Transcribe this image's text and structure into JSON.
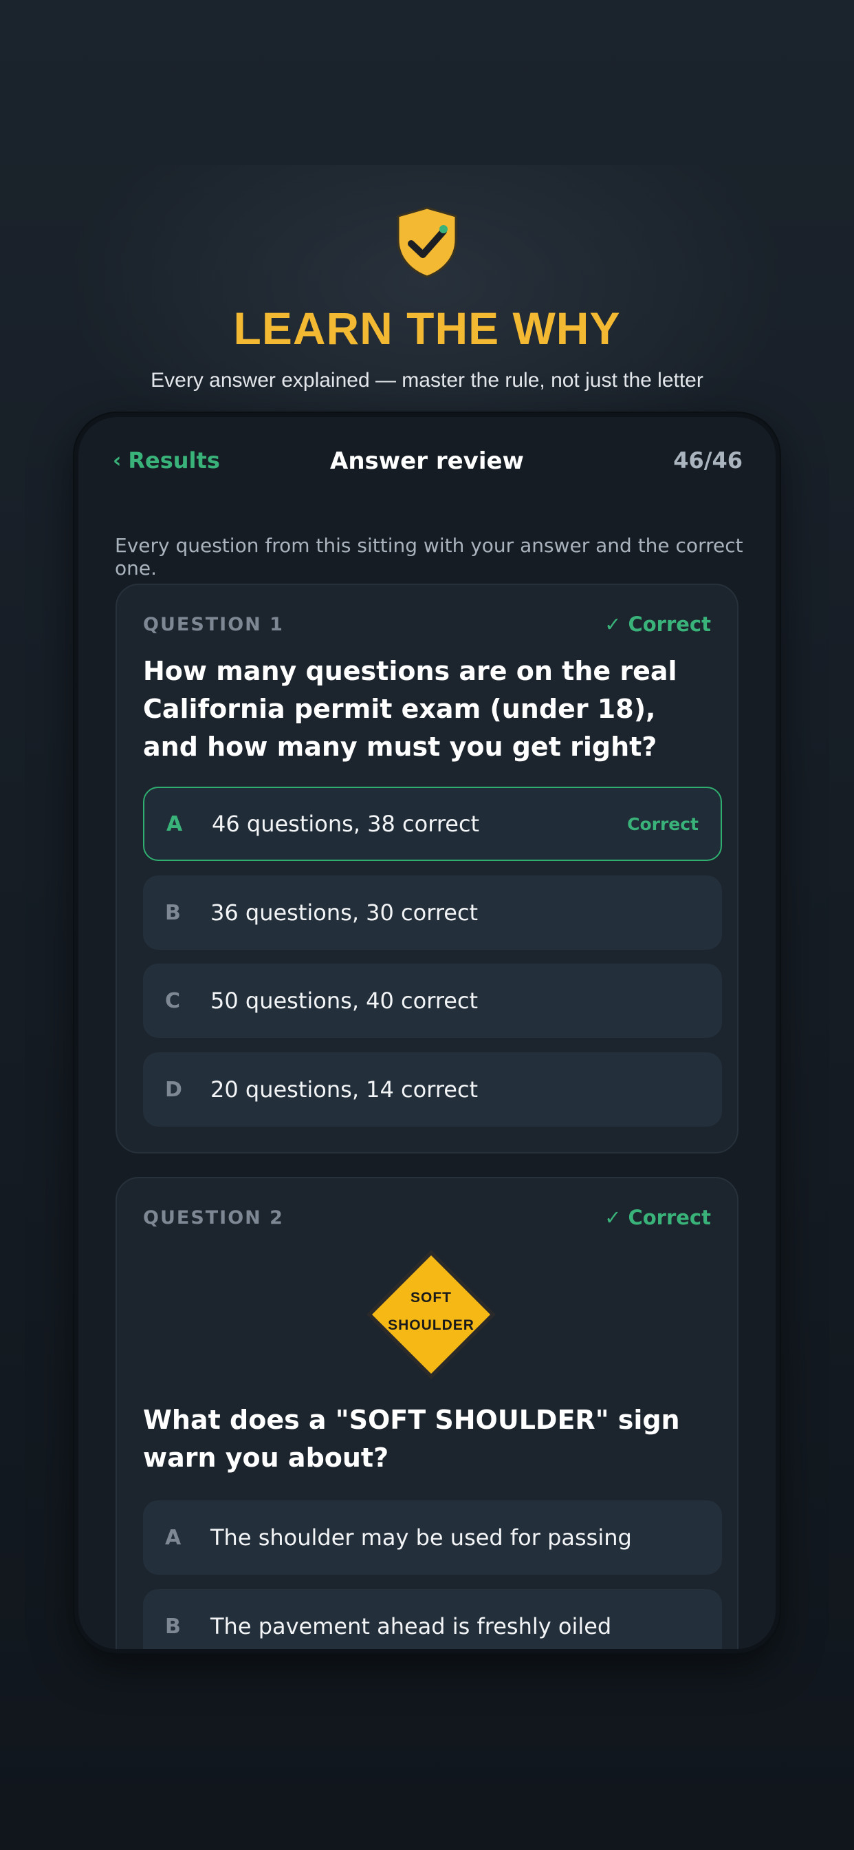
{
  "hero": {
    "icon": "shield-check-icon",
    "title": "LEARN THE WHY",
    "subtitle": "Every answer explained — master the rule, not just the letter"
  },
  "nav": {
    "back_label": "Results",
    "back_icon": "chevron-left-icon",
    "title": "Answer review",
    "count": "46/46"
  },
  "intro": "Every question from this sitting with your answer and the correct one.",
  "colors": {
    "accent_gold": "#f4b933",
    "correct_green": "#3ab37a",
    "sign_yellow": "#f5b814"
  },
  "questions": [
    {
      "label": "QUESTION 1",
      "status": "✓ Correct",
      "text": "How many questions are on the real California permit exam (under 18), and how many must you get right?",
      "options": [
        {
          "letter": "A",
          "text": "46 questions, 38 correct",
          "badge": "Correct"
        },
        {
          "letter": "B",
          "text": "36 questions, 30 correct"
        },
        {
          "letter": "C",
          "text": "50 questions, 40 correct"
        },
        {
          "letter": "D",
          "text": "20 questions, 14 correct"
        }
      ]
    },
    {
      "label": "QUESTION 2",
      "status": "✓ Correct",
      "sign": {
        "icon": "soft-shoulder-sign-icon",
        "line1": "SOFT",
        "line2": "SHOULDER"
      },
      "text": "What does a \"SOFT SHOULDER\" sign warn you about?",
      "options": [
        {
          "letter": "A",
          "text": "The shoulder may be used for passing"
        },
        {
          "letter": "B",
          "text": "The pavement ahead is freshly oiled"
        }
      ]
    }
  ]
}
